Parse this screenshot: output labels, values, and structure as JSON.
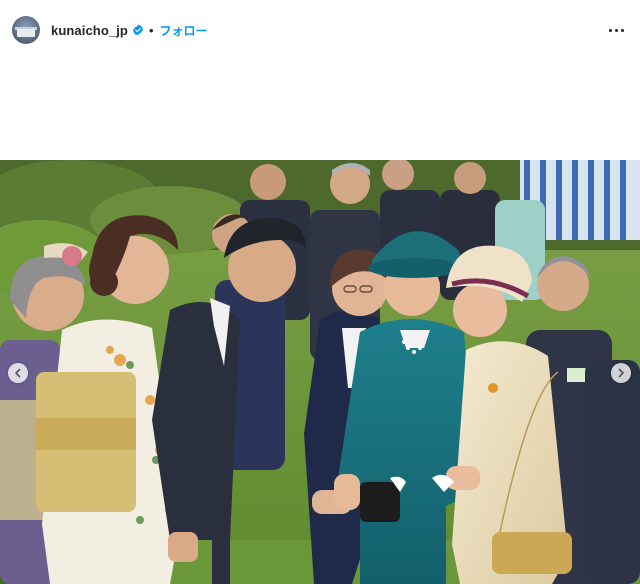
{
  "post": {
    "username": "kunaicho_jp",
    "verified": true,
    "follow_label": "フォロー",
    "separator": "•"
  },
  "icons": {
    "avatar": "profile-photo",
    "verified": "verified-badge-icon",
    "more": "more-options-icon",
    "prev": "chevron-left-icon",
    "next": "chevron-right-icon"
  },
  "colors": {
    "follow": "#0095f6",
    "verified": "#0095f6",
    "text": "#262626"
  }
}
